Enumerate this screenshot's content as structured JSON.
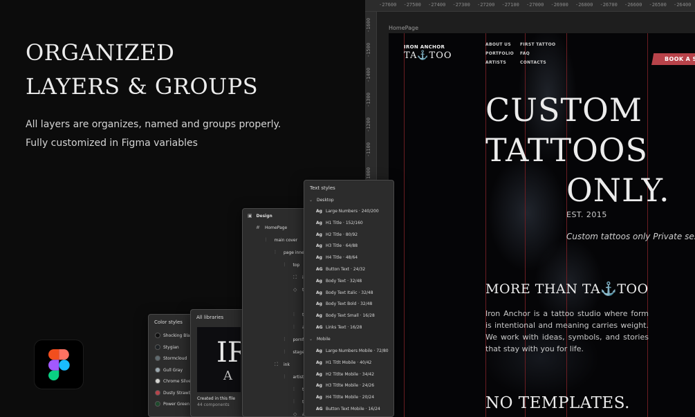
{
  "promo": {
    "title_line1": "ORGANIZED",
    "title_line2": "LAYERS & GROUPS",
    "subtitle_line1": "All layers are organizes, named and groups properly.",
    "subtitle_line2": "Fully customized in Figma variables"
  },
  "canvas": {
    "ruler_x": [
      "-27600",
      "-27500",
      "-27400",
      "-27300",
      "-27200",
      "-27100",
      "-27000",
      "-26900",
      "-26800",
      "-26700",
      "-26600",
      "-26500",
      "-26400"
    ],
    "ruler_y": [
      "-1600",
      "-1500",
      "-1400",
      "-1300",
      "-1200",
      "-1100",
      "-1000"
    ],
    "frame_label": "HomePage"
  },
  "site": {
    "logo_top": "IRON ANCHOR",
    "logo_bottom": "TA⚓TOO",
    "nav_col1": [
      "ABOUT US",
      "PORTFOLIO",
      "ARTISTS"
    ],
    "nav_col2": [
      "FIRST TATTOO",
      "FAQ",
      "CONTACTS"
    ],
    "book_button": "BOOK A SE",
    "hero_line1": "CUSTOM",
    "hero_line2": "TATTOOS",
    "hero_line3": "ONLY.",
    "est": "EST. 2015",
    "tagline": "Custom tattoos only   Private sessi",
    "more_heading": "MORE THAN TA⚓TOO",
    "paragraph": "Iron Anchor is a tattoo studio where form is intentional and meaning carries weight. We work with ideas, symbols, and stories that stay with you for life.",
    "no_templates": "NO TEMPLATES."
  },
  "color_styles": {
    "title": "Color styles",
    "items": [
      {
        "name": "Shocking Blac",
        "color": "#111111"
      },
      {
        "name": "Stygian",
        "color": "#1f2326"
      },
      {
        "name": "Stormcloud",
        "color": "#5f6b70"
      },
      {
        "name": "Gull Gray",
        "color": "#9aa6ad"
      },
      {
        "name": "Chrome Silve",
        "color": "#d4d4d0"
      },
      {
        "name": "Dusty Strawb",
        "color": "#b8434a"
      },
      {
        "name": "Power Green",
        "color": "#1e4a2c"
      }
    ]
  },
  "libraries": {
    "title": "All libraries",
    "thumb_big": "IR",
    "thumb_small": "A",
    "caption": "Created in this file",
    "count": "44 components"
  },
  "layers": {
    "title": "Design",
    "items": [
      {
        "label": "HomePage",
        "icon": "frame-icon",
        "indent": 0
      },
      {
        "label": "main cover",
        "icon": "auto-layout-icon",
        "indent": 1
      },
      {
        "label": "page inner",
        "icon": "auto-layout-icon",
        "indent": 2
      },
      {
        "label": "top",
        "icon": "auto-layout-icon",
        "indent": 3
      },
      {
        "label": "i",
        "icon": "component-frame-icon",
        "indent": 4
      },
      {
        "label": "t",
        "icon": "component-icon",
        "indent": 4
      },
      {
        "label": "",
        "icon": "",
        "indent": 4
      },
      {
        "label": "t",
        "icon": "auto-layout-icon",
        "indent": 4
      },
      {
        "label": "a",
        "icon": "auto-layout-icon",
        "indent": 4
      },
      {
        "label": "pornf",
        "icon": "auto-layout-icon",
        "indent": 3
      },
      {
        "label": "stage",
        "icon": "auto-layout-icon",
        "indent": 3
      },
      {
        "label": "ink",
        "icon": "component-frame-icon",
        "indent": 2
      },
      {
        "label": "artist",
        "icon": "auto-layout-icon",
        "indent": 3
      },
      {
        "label": "t",
        "icon": "auto-layout-icon",
        "indent": 4
      },
      {
        "label": "t",
        "icon": "auto-layout-icon",
        "indent": 4
      },
      {
        "label": "a",
        "icon": "component-icon",
        "indent": 4
      }
    ]
  },
  "text_styles": {
    "title": "Text styles",
    "desktop_label": "Desktop",
    "mobile_label": "Mobile",
    "desktop": [
      {
        "icon": "Ag",
        "label": "Large Numbers · 240/200"
      },
      {
        "icon": "Ag",
        "label": "H1 Title · 152/160"
      },
      {
        "icon": "Ag",
        "label": "H2 Title · 80/92"
      },
      {
        "icon": "Ag",
        "label": "H3 Title · 64/88"
      },
      {
        "icon": "Ag",
        "label": "H4 Title · 48/64"
      },
      {
        "icon": "AG",
        "label": "Button Text · 24/32"
      },
      {
        "icon": "Ag",
        "label": "Body Text · 32/48"
      },
      {
        "icon": "Ag",
        "label": "Body Text Italic · 32/48"
      },
      {
        "icon": "Ag",
        "label": "Body Text Bold · 32/48"
      },
      {
        "icon": "Ag",
        "label": "Body Text Small · 16/28"
      },
      {
        "icon": "AG",
        "label": "Links Text · 16/28"
      }
    ],
    "mobile": [
      {
        "icon": "Ag",
        "label": "Large Numbers Mobile · 72/80"
      },
      {
        "icon": "Ag",
        "label": "H1 Titlt Mobile · 40/42"
      },
      {
        "icon": "Ag",
        "label": "H2 Titlte Mobile · 34/42"
      },
      {
        "icon": "Ag",
        "label": "H3 Titlte Mobile · 24/26"
      },
      {
        "icon": "Ag",
        "label": "H4 Titlte Mobile · 20/24"
      },
      {
        "icon": "AG",
        "label": "Button Text Mobile · 16/24"
      }
    ]
  }
}
